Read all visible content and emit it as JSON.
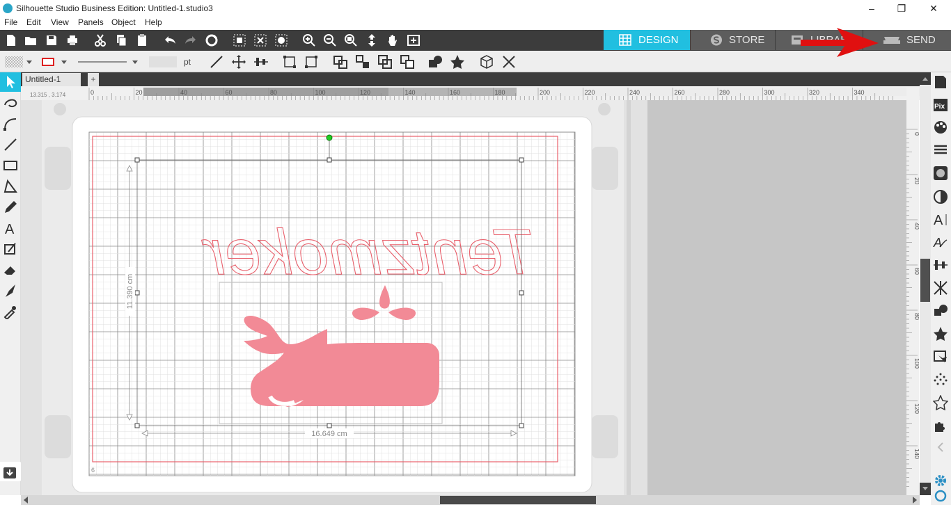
{
  "window": {
    "title": "Silhouette Studio Business Edition: Untitled-1.studio3",
    "minimize": "–",
    "restore": "❐",
    "close": "✕"
  },
  "menu": [
    "File",
    "Edit",
    "View",
    "Panels",
    "Object",
    "Help"
  ],
  "mode_tabs": {
    "design": "DESIGN",
    "store": "STORE",
    "library": "LIBRARY",
    "send": "SEND"
  },
  "line_style": {
    "width_value": "",
    "unit": "pt"
  },
  "document_tab": {
    "name": "Untitled-1",
    "add_label": "+"
  },
  "coordinates_readout": "13.315 , 3.174",
  "ruler_top_labels": [
    "0",
    "20",
    "40",
    "60",
    "80",
    "100",
    "120",
    "140",
    "160",
    "180",
    "200",
    "220",
    "240",
    "260",
    "280",
    "300",
    "320",
    "340"
  ],
  "ruler_right_labels": [
    "0",
    "20",
    "40",
    "60",
    "80",
    "100",
    "120",
    "140"
  ],
  "selection": {
    "width": "16.649 cm",
    "height": "11.390 cm"
  },
  "page_marker": "6",
  "design": {
    "script_text": "Tentzmoker",
    "whale_color": "#f28a96",
    "cut_line_color": "#e8606c"
  },
  "colors": {
    "accent": "#21bfe0",
    "toolbar_dark": "#3c3c3c",
    "annotation_red": "#e01010"
  }
}
